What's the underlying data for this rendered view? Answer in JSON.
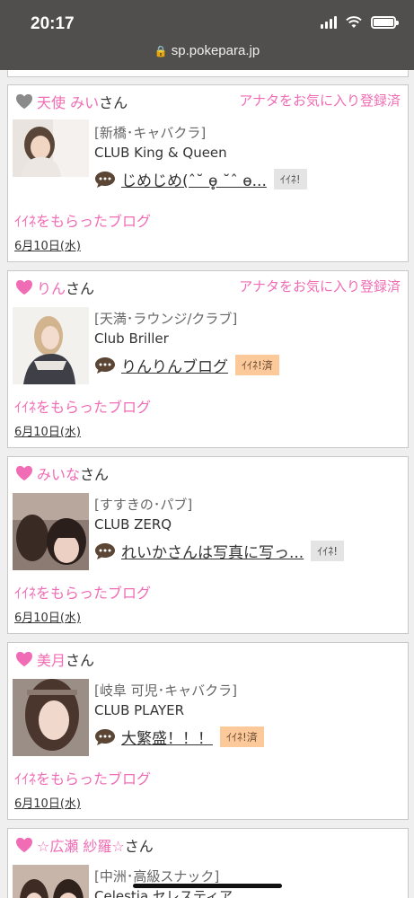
{
  "status": {
    "time": "20:17",
    "url": "sp.pokepara.jp"
  },
  "labels": {
    "san": "さん",
    "favorite": "アナタをお気に入り登録済",
    "received": "ｲｲﾈをもらったブログ"
  },
  "colors": {
    "pink": "#f06cb4",
    "heart_gray": "#8a8a8a",
    "iine_done": "#fcc99b"
  },
  "cards": [
    {
      "name": "天使 みい",
      "heart": "gray",
      "show_favorite": true,
      "area": "[新橋･キャバクラ]",
      "club": "CLUB King & Queen",
      "blog_title": "じめじめ(ˆ˘ ɵ̥̥ ˘ˆ ɵ...",
      "iine": "ｲｲﾈ!",
      "iine_done": false,
      "date": "6月10日(水)"
    },
    {
      "name": "りん",
      "heart": "pink",
      "show_favorite": true,
      "area": "[天満･ラウンジ/クラブ]",
      "club": "Club Briller",
      "blog_title": "りんりんブログ",
      "iine": "ｲｲﾈ!済",
      "iine_done": true,
      "date": "6月10日(水)"
    },
    {
      "name": "みいな",
      "heart": "pink",
      "show_favorite": false,
      "area": "[すすきの･パブ]",
      "club": "CLUB ZERQ",
      "blog_title": "れいかさんは写真に写っ...",
      "iine": "ｲｲﾈ!",
      "iine_done": false,
      "date": "6月10日(水)"
    },
    {
      "name": "美月",
      "heart": "pink",
      "show_favorite": false,
      "area": "[岐阜 可児･キャバクラ]",
      "club": "CLUB PLAYER",
      "blog_title": "大繁盛！！！",
      "iine": "ｲｲﾈ!済",
      "iine_done": true,
      "date": "6月10日(水)"
    },
    {
      "name": "☆広瀬 紗羅☆",
      "heart": "pink",
      "show_favorite": false,
      "area": "[中洲･高級スナック]",
      "club": "Celestia セレスティア"
    }
  ]
}
